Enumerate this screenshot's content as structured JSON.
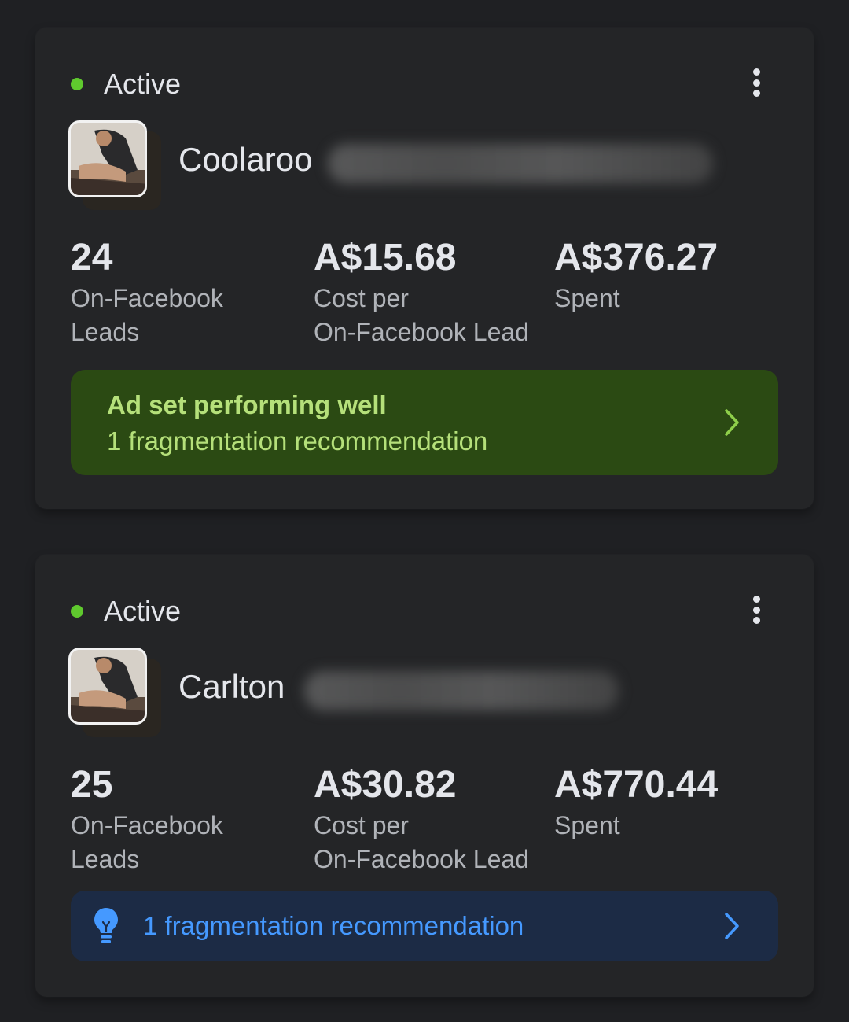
{
  "adsets": [
    {
      "status": "Active",
      "name": "Coolaroo",
      "metrics": [
        {
          "value": "24",
          "label": "On-Facebook\nLeads"
        },
        {
          "value": "A$15.68",
          "label": "Cost per\nOn-Facebook Lead"
        },
        {
          "value": "A$376.27",
          "label": "Spent"
        }
      ],
      "banner": {
        "title": "Ad set performing well",
        "subtitle": "1 fragmentation recommendation"
      }
    },
    {
      "status": "Active",
      "name": "Carlton",
      "metrics": [
        {
          "value": "25",
          "label": "On-Facebook\nLeads"
        },
        {
          "value": "A$30.82",
          "label": "Cost per\nOn-Facebook Lead"
        },
        {
          "value": "A$770.44",
          "label": "Spent"
        }
      ],
      "banner": {
        "subtitle": "1 fragmentation recommendation"
      }
    }
  ],
  "colors": {
    "background": "#1f2023",
    "card": "#242527",
    "active_dot": "#5fc92e",
    "green_banner": "#2b4a13",
    "green_text": "#b5e07a",
    "blue_banner": "#1c2b45",
    "blue_text": "#4599ff"
  },
  "icons": [
    "status-dot",
    "more-vertical-icon",
    "adset-thumbnail",
    "chevron-right-icon",
    "lightbulb-icon"
  ]
}
